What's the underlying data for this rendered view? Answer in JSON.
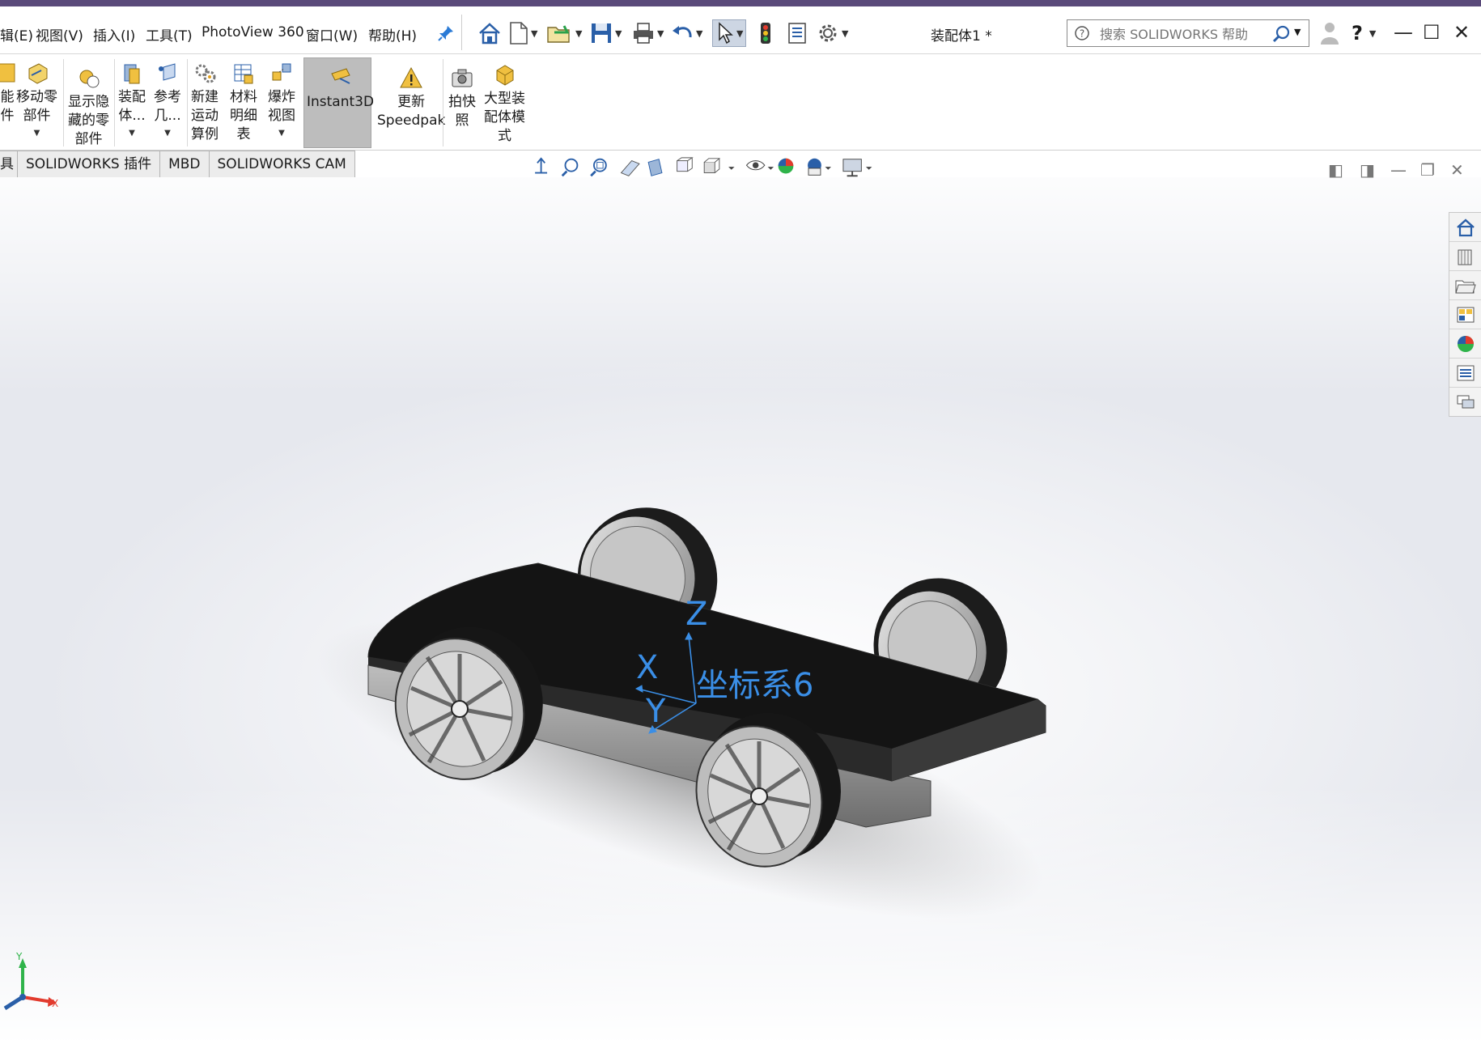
{
  "menu": {
    "edit": "辑(E)",
    "view": "视图(V)",
    "insert": "插入(I)",
    "tools": "工具(T)",
    "photoview": "PhotoView 360",
    "window": "窗口(W)",
    "help": "帮助(H)"
  },
  "document_title": "装配体1 *",
  "search": {
    "placeholder": "搜索 SOLIDWORKS 帮助"
  },
  "ribbon": {
    "cut_left": "能\n件",
    "move_component": "移动零\n部件",
    "show_hidden": "显示隐\n藏的零\n部件",
    "assembly_features": "装配\n体...",
    "reference_geometry": "参考\n几...",
    "new_motion_study": "新建\n运动\n算例",
    "bom": "材料\n明细\n表",
    "exploded_view": "爆炸\n视图",
    "instant3d": "Instant3D",
    "update_speedpak": "更新\nSpeedpak",
    "snapshot": "拍快\n照",
    "large_assembly": "大型装\n配体模\n式"
  },
  "tabs": [
    "具",
    "SOLIDWORKS 插件",
    "MBD",
    "SOLIDWORKS CAM"
  ],
  "scene": {
    "coord_label": "坐标系6",
    "axis_x": "X",
    "axis_y": "Y",
    "axis_z": "Z",
    "triad_x": "X",
    "triad_y": "Y"
  },
  "colors": {
    "title_strip": "#5a4a7a",
    "coord_blue": "#3a8ee6",
    "body": "#141414"
  }
}
